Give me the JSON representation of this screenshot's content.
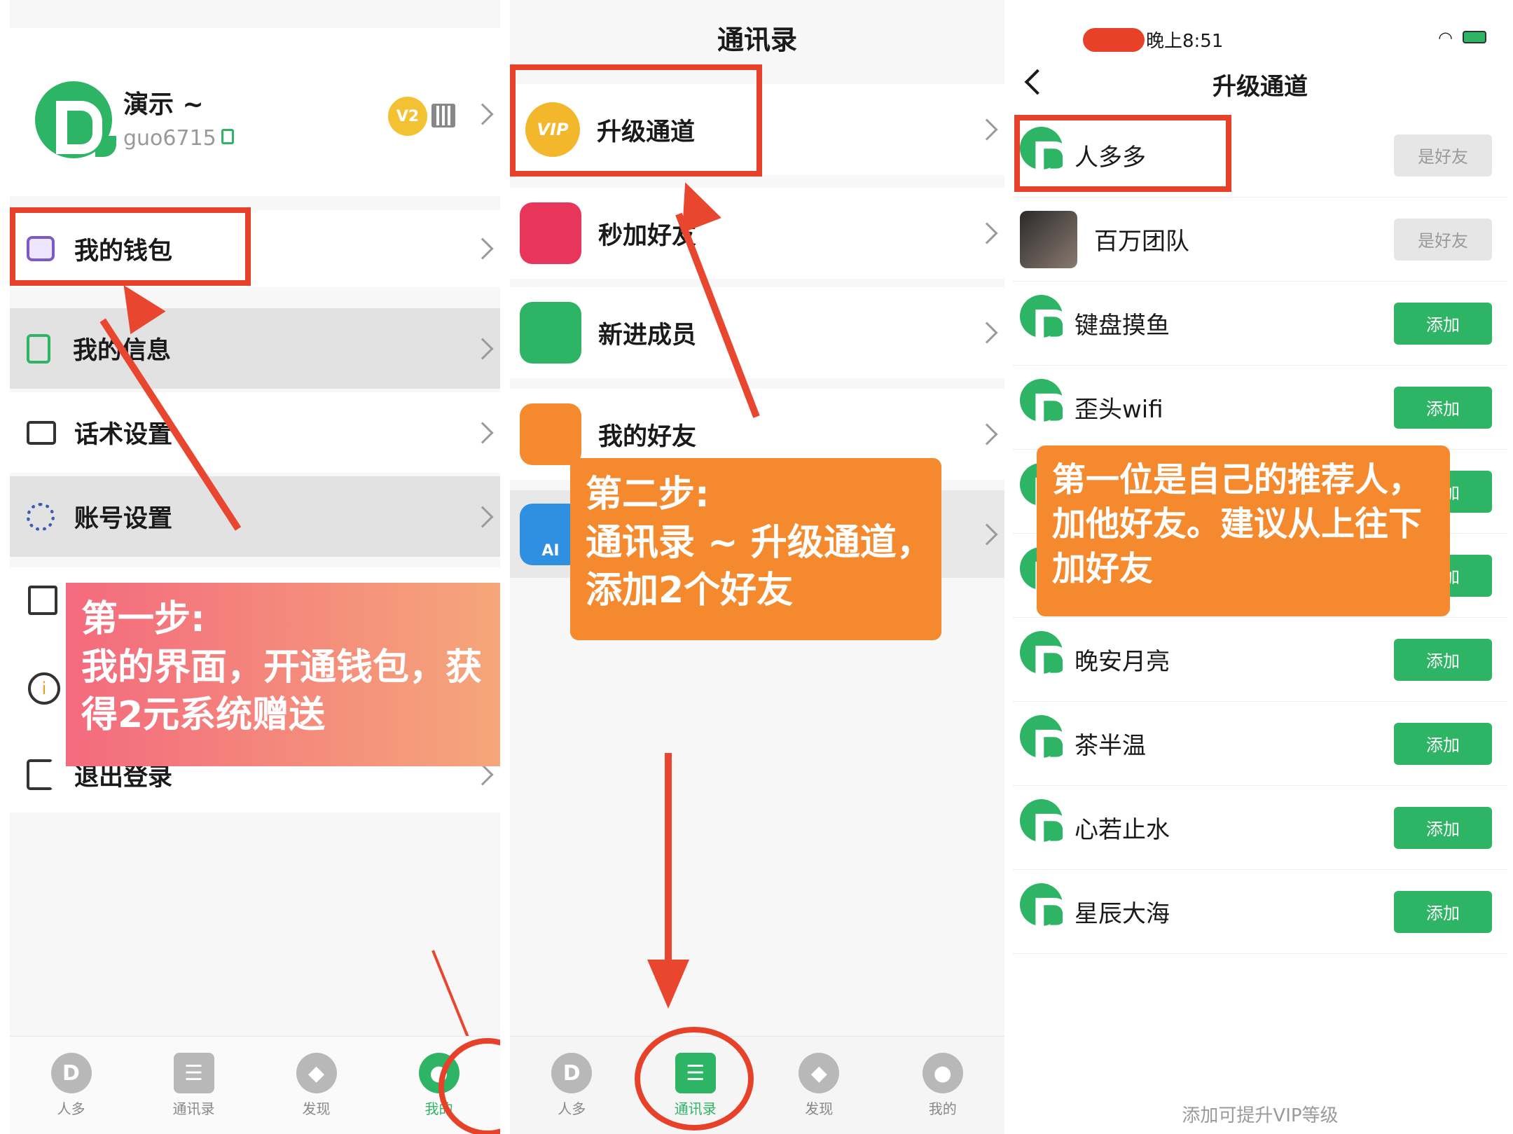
{
  "panel1": {
    "profile": {
      "name": "演示 ~",
      "id": "guo6715",
      "level_badge": "V2"
    },
    "menu": [
      {
        "label": "我的钱包",
        "icon": "wallet-icon"
      },
      {
        "label": "我的信息",
        "icon": "document-icon"
      },
      {
        "label": "话术设置",
        "icon": "script-icon"
      },
      {
        "label": "账号设置",
        "icon": "gear-icon"
      },
      {
        "label": "退出登录",
        "icon": "logout-icon"
      }
    ],
    "callout": {
      "line1": "第一步:",
      "line2": "我的界面，开通钱包，获",
      "line3": "得2元系统赠送"
    },
    "tabs": [
      {
        "label": "人多",
        "icon": "renduo-logo-icon"
      },
      {
        "label": "通讯录",
        "icon": "contacts-icon"
      },
      {
        "label": "发现",
        "icon": "compass-icon"
      },
      {
        "label": "我的",
        "icon": "person-icon"
      }
    ]
  },
  "panel2": {
    "title": "通讯录",
    "menu": [
      {
        "label": "升级通道",
        "icon": "vip-icon"
      },
      {
        "label": "秒加好友",
        "icon": "quick-add-icon"
      },
      {
        "label": "新进成员",
        "icon": "new-member-icon"
      },
      {
        "label": "我的好友",
        "icon": "friends-icon"
      }
    ],
    "vip_text": "VIP",
    "ai_text": "AI",
    "callout": {
      "line1": "第二步:",
      "line2": "通讯录 ~ 升级通道，",
      "line3": "添加2个好友"
    },
    "tabs": [
      {
        "label": "人多",
        "icon": "renduo-logo-icon"
      },
      {
        "label": "通讯录",
        "icon": "contacts-icon"
      },
      {
        "label": "发现",
        "icon": "compass-icon"
      },
      {
        "label": "我的",
        "icon": "person-icon"
      }
    ]
  },
  "panel3": {
    "status_time": "晚上8:51",
    "title": "升级通道",
    "contacts": [
      {
        "name": "人多多",
        "action": "是好友",
        "state": "friend"
      },
      {
        "name": "百万团队",
        "action": "是好友",
        "state": "friend"
      },
      {
        "name": "键盘摸鱼",
        "action": "添加",
        "state": "add"
      },
      {
        "name": "歪头wifi",
        "action": "添加",
        "state": "add"
      },
      {
        "name": "",
        "action": "添加",
        "state": "add"
      },
      {
        "name": "",
        "action": "添加",
        "state": "add"
      },
      {
        "name": "晚安月亮",
        "action": "添加",
        "state": "add"
      },
      {
        "name": "茶半温",
        "action": "添加",
        "state": "add"
      },
      {
        "name": "心若止水",
        "action": "添加",
        "state": "add"
      },
      {
        "name": "星辰大海",
        "action": "添加",
        "state": "add"
      }
    ],
    "callout": {
      "line1": "第一位是自己的推荐人，",
      "line2": "加他好友。建议从上往下",
      "line3": "加好友"
    },
    "footer": "添加可提升VIP等级"
  },
  "colors": {
    "brand_green": "#2db464",
    "annotation_red": "#e8412a",
    "callout_orange": "#f5892e"
  }
}
